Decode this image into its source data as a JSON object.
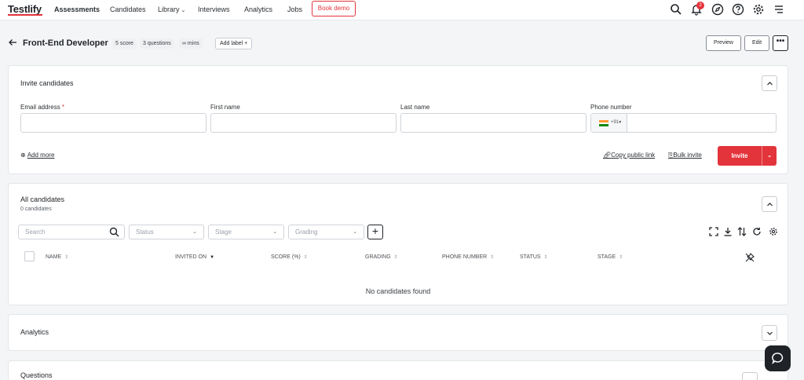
{
  "nav": {
    "logo": "Testlify",
    "items": [
      {
        "label": "Assessments",
        "active": true
      },
      {
        "label": "Candidates"
      },
      {
        "label": "Library",
        "dropdown": true
      },
      {
        "label": "Interviews"
      },
      {
        "label": "Analytics"
      },
      {
        "label": "Jobs"
      }
    ],
    "book_demo": "Book demo",
    "notification_count": "2",
    "icons": [
      "search-icon",
      "bell-icon",
      "compass-icon",
      "help-icon",
      "gear-icon",
      "menu-icon"
    ]
  },
  "header": {
    "title": "Front-End Developer",
    "pills": [
      "5 score",
      "3 questions",
      "∞ mins"
    ],
    "add_label": "Add label +",
    "preview": "Preview",
    "edit": "Edit",
    "more": "•••"
  },
  "invite": {
    "title": "Invite candidates",
    "email_label": "Email address",
    "required_mark": "*",
    "first_name_label": "First name",
    "last_name_label": "Last name",
    "phone_label": "Phone number",
    "phone_code": "+91",
    "add_more": "Add more",
    "copy_link": "Copy public link",
    "bulk_invite": "Bulk invite",
    "invite_button": "Invite"
  },
  "candidates": {
    "title": "All candidates",
    "count": "0 candidates",
    "search_placeholder": "Search",
    "filters": [
      "Status",
      "Stage",
      "Grading"
    ],
    "columns": [
      "Name",
      "Invited on",
      "Score (%)",
      "Grading",
      "Phone number",
      "Status",
      "Stage"
    ],
    "empty_text": "No candidates found"
  },
  "analytics": {
    "title": "Analytics"
  },
  "questions": {
    "title": "Questions"
  },
  "colors": {
    "accent": "#e3343b",
    "text": "#1f2328",
    "background": "#f4f5f7"
  }
}
